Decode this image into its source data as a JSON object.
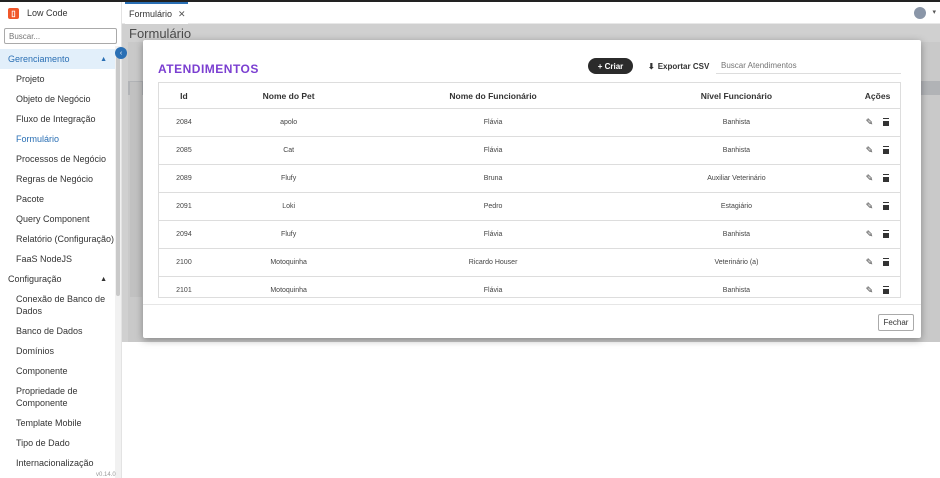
{
  "app": {
    "name": "Low Code",
    "version": "v0.14.0"
  },
  "sidebar": {
    "search_placeholder": "Buscar...",
    "sections": [
      {
        "label": "Gerenciamento",
        "active": true,
        "items": [
          {
            "label": "Projeto"
          },
          {
            "label": "Objeto de Negócio"
          },
          {
            "label": "Fluxo de Integração"
          },
          {
            "label": "Formulário",
            "active": true
          },
          {
            "label": "Processos de Negócio"
          },
          {
            "label": "Regras de Negócio"
          },
          {
            "label": "Pacote"
          },
          {
            "label": "Query Component"
          },
          {
            "label": "Relatório (Configuração)"
          },
          {
            "label": "FaaS NodeJS"
          }
        ]
      },
      {
        "label": "Configuração",
        "items": [
          {
            "label": "Conexão de Banco de Dados"
          },
          {
            "label": "Banco de Dados"
          },
          {
            "label": "Domínios"
          },
          {
            "label": "Componente"
          },
          {
            "label": "Propriedade de Componente"
          },
          {
            "label": "Template Mobile"
          },
          {
            "label": "Tipo de Dado"
          },
          {
            "label": "Internacionalização"
          }
        ]
      }
    ]
  },
  "tabs": [
    {
      "label": "Formulário",
      "close": "✕"
    }
  ],
  "page": {
    "title": "Formulário"
  },
  "modal": {
    "title": "ATENDIMENTOS",
    "create_label": "Criar",
    "export_label": "Exportar CSV",
    "search_placeholder": "Buscar Atendimentos",
    "columns": [
      "Id",
      "Nome do Pet",
      "Nome do Funcionário",
      "Nível Funcionário",
      "Ações"
    ],
    "rows": [
      {
        "id": "2084",
        "pet": "apolo",
        "func": "Flávia",
        "nivel": "Banhista"
      },
      {
        "id": "2085",
        "pet": "Cat",
        "func": "Flávia",
        "nivel": "Banhista"
      },
      {
        "id": "2089",
        "pet": "Flufy",
        "func": "Bruna",
        "nivel": "Auxiliar Veterinário"
      },
      {
        "id": "2091",
        "pet": "Loki",
        "func": "Pedro",
        "nivel": "Estagiário"
      },
      {
        "id": "2094",
        "pet": "Flufy",
        "func": "Flávia",
        "nivel": "Banhista"
      },
      {
        "id": "2100",
        "pet": "Motoquinha",
        "func": "Ricardo Houser",
        "nivel": "Veterinário (a)"
      },
      {
        "id": "2101",
        "pet": "Motoquinha",
        "func": "Flávia",
        "nivel": "Banhista"
      }
    ],
    "close_label": "Fechar"
  },
  "colors": {
    "accent": "#2a6fb4",
    "title_purple": "#7b3fd1",
    "brand_orange": "#f0572a",
    "create_button": "#2b2b2b"
  }
}
